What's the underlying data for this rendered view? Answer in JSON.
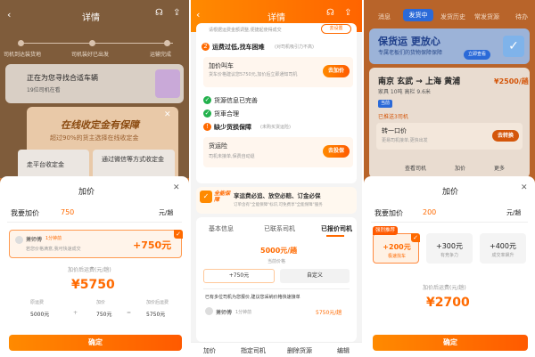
{
  "p1": {
    "title": "详情",
    "steps": [
      "司机到达装货地",
      "司机装好已出发",
      "运输完成"
    ],
    "matching": "正在为您寻找合适车辆",
    "matching_sub": "19位司机在看",
    "banner_title": "在线收定金有保障",
    "banner_sub": "超过90%的货主选择在线收定金",
    "opt_a": "走平台收定金",
    "opt_b": "通过微信等方式收定金",
    "sheet_title": "加价",
    "label": "我要加价",
    "amount": "750",
    "unit": "元/趟",
    "driver_name": "萧师傅",
    "driver_time": "1分钟前",
    "driver_msg": "若您价格满意,我可快速成交",
    "driver_price": "+750元",
    "sum_label": "加价后运费(元/趟)",
    "sum_value": "¥5750",
    "f1_label": "原运费",
    "f1_value": "5000元",
    "f2_label": "加价",
    "f2_value": "750元",
    "f3_label": "加价后运费",
    "f3_value": "5750元",
    "op_plus": "+",
    "op_eq": "=",
    "confirm": "确定"
  },
  "p2": {
    "title": "详情",
    "top_hint": "请根据运费金额调整,便捷起使得成交",
    "top_btn": "去设置",
    "s1_title": "运费过低,找车困难",
    "s1_note": "(对司机吸引力不高)",
    "s1_card_title": "加价叫车",
    "s1_card_sub": "货车价格建议您5750元,加价后立即通知司机",
    "s1_btn": "去加价",
    "ok1": "货源信息已完善",
    "ok2": "货車合理",
    "s3_title": "缺少货损保障",
    "s3_note": "(未购买货运险)",
    "s3_card_title": "货运险",
    "s3_card_sub": "司机未接单,保费自动退",
    "s3_btn": "去投保",
    "promo_badge": "全能保障",
    "promo_title": "享运费必追、放空必赔、订金必保",
    "promo_sub": "订单含有\"全能保障\"标识,可免费享\"全能保障\"服务",
    "tabs": [
      "基本信息",
      "已联系司机",
      "已报价司机"
    ],
    "quote_price": "5000元/趟",
    "quote_label": "当前价格",
    "quote_opt1": "+750元",
    "quote_opt2": "自定义",
    "quote_hint": "已有多位司机为您报价,建议您采纳价格快速接单",
    "driver_name": "萧师傅",
    "driver_time": "1分钟前",
    "driver_price": "5750元/趟",
    "bottom": [
      "加价",
      "指定司机",
      "删除货源",
      "编辑"
    ]
  },
  "p3": {
    "tabs": [
      "消息",
      "发货中",
      "发货历史",
      "常发货源"
    ],
    "tab_right": "待办",
    "banner_title": "保货运 更放心",
    "banner_sub": "专属老板们的货物保障保障",
    "banner_btn": "立即查看",
    "route": "南京 玄武 → 上海 黄浦",
    "cargo": "家具 10吨 高栏 9.6米",
    "price": "¥2500/趟",
    "tag": "当前",
    "seen": "已推送3司机",
    "switch_title": "转一口价",
    "switch_sub": "更易司机接单,更快出发",
    "switch_btn": "去转换",
    "actions": [
      "查看司机",
      "加价",
      "更多"
    ],
    "sheet_title": "加价",
    "label": "我要加价",
    "amount": "200",
    "unit": "元/趟",
    "rec_tag": "强烈推荐",
    "opts": [
      {
        "value": "+200元",
        "sub": "极速找车"
      },
      {
        "value": "+300元",
        "sub": "有竞争力"
      },
      {
        "value": "+400元",
        "sub": "成交率飙升"
      }
    ],
    "sum_label": "加价后运费(元/趟)",
    "sum_value": "¥2700",
    "confirm": "确定"
  }
}
